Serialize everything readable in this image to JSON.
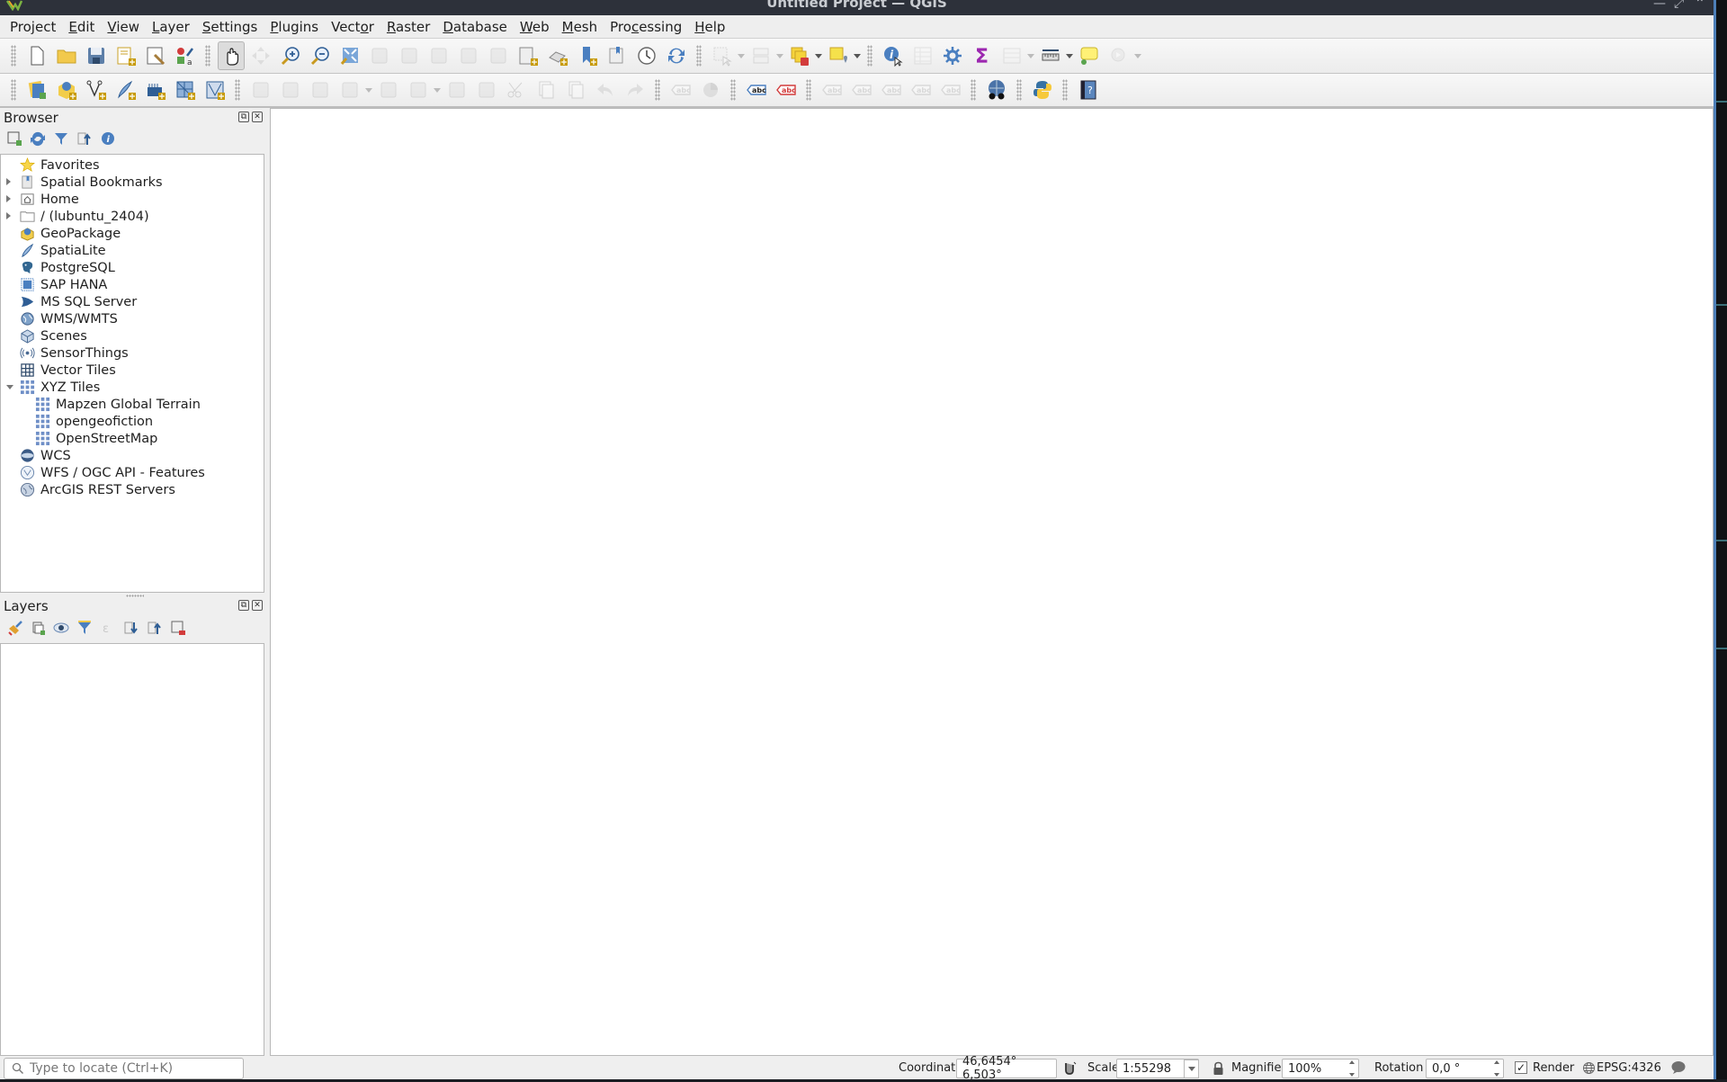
{
  "window": {
    "title": "Untitled Project — QGIS",
    "controls": [
      "minimize",
      "maximize",
      "close"
    ]
  },
  "menubar": {
    "items": [
      {
        "label": "Project",
        "mnemonic_index": 3
      },
      {
        "label": "Edit",
        "mnemonic_index": 0
      },
      {
        "label": "View",
        "mnemonic_index": 0
      },
      {
        "label": "Layer",
        "mnemonic_index": 0
      },
      {
        "label": "Settings",
        "mnemonic_index": 0
      },
      {
        "label": "Plugins",
        "mnemonic_index": 0
      },
      {
        "label": "Vector",
        "mnemonic_index": 4
      },
      {
        "label": "Raster",
        "mnemonic_index": 0
      },
      {
        "label": "Database",
        "mnemonic_index": 0
      },
      {
        "label": "Web",
        "mnemonic_index": 0
      },
      {
        "label": "Mesh",
        "mnemonic_index": 0
      },
      {
        "label": "Processing",
        "mnemonic_index": 3
      },
      {
        "label": "Help",
        "mnemonic_index": 0
      }
    ]
  },
  "toolbar1": {
    "groups": [
      [
        "new-project-icon",
        "open-project-icon",
        "save-project-icon",
        "new-print-layout-icon",
        "layout-manager-icon",
        "style-manager-icon"
      ],
      [
        "pan-icon",
        "pan-to-selection-icon",
        "zoom-in-icon",
        "zoom-out-icon",
        "zoom-full-icon",
        "zoom-to-selection-icon",
        "zoom-to-layer-icon",
        "zoom-native-icon",
        "zoom-last-icon",
        "zoom-next-icon",
        "new-map-view-icon",
        "new-3d-map-view-icon",
        "new-bookmark-icon",
        "show-bookmarks-icon",
        "temporal-controller-icon",
        "refresh-icon"
      ],
      [
        "select-features-icon",
        "attribute-table-select-icon",
        "deselect-icon",
        "select-by-location-icon"
      ],
      [
        "identify-icon",
        "attribute-table-icon",
        "processing-toolbox-icon",
        "statistics-icon",
        "open-field-calculator-icon",
        "measure-icon",
        "map-tips-icon",
        "run-action-icon"
      ]
    ],
    "active_tool": "pan-icon"
  },
  "toolbar2": {
    "groups": [
      [
        "data-source-manager-icon",
        "new-geopackage-layer-icon",
        "new-shapefile-layer-icon",
        "new-spatialite-layer-icon",
        "new-virtual-layer-icon",
        "new-mesh-layer-icon",
        "new-vector-tile-icon"
      ],
      [
        "current-edits-icon",
        "toggle-editing-icon",
        "save-edits-icon",
        "digitize-icon",
        "add-polygon-icon",
        "vertex-tool-icon",
        "modify-attributes-icon",
        "delete-selected-icon",
        "cut-icon",
        "copy-icon",
        "paste-icon",
        "undo-icon",
        "redo-icon"
      ],
      [
        "label-toolbar-icon",
        "diagram-icon"
      ],
      [
        "layer-labeling-icon",
        "layer-labeling-rule-icon"
      ],
      [
        "pin-labels-icon",
        "show-hide-labels-icon",
        "move-label-icon",
        "rotate-label-icon",
        "change-label-icon"
      ],
      [
        "metasearch-icon"
      ],
      [
        "python-console-icon"
      ],
      [
        "help-icon"
      ]
    ]
  },
  "browser": {
    "title": "Browser",
    "toolbar": [
      "add-selected-layers-icon",
      "refresh-icon",
      "filter-icon",
      "collapse-all-icon",
      "info-icon"
    ],
    "items": [
      {
        "label": "Favorites",
        "icon": "star-icon",
        "expander": "none",
        "depth": 0
      },
      {
        "label": "Spatial Bookmarks",
        "icon": "bookmark-icon",
        "expander": "collapsed",
        "depth": 0
      },
      {
        "label": "Home",
        "icon": "home-folder-icon",
        "expander": "collapsed",
        "depth": 0
      },
      {
        "label": "/ (lubuntu_2404)",
        "icon": "folder-icon",
        "expander": "collapsed",
        "depth": 0
      },
      {
        "label": "GeoPackage",
        "icon": "geopackage-icon",
        "expander": "none",
        "depth": 0
      },
      {
        "label": "SpatiaLite",
        "icon": "spatialite-icon",
        "expander": "none",
        "depth": 0
      },
      {
        "label": "PostgreSQL",
        "icon": "postgresql-icon",
        "expander": "none",
        "depth": 0
      },
      {
        "label": "SAP HANA",
        "icon": "sap-hana-icon",
        "expander": "none",
        "depth": 0
      },
      {
        "label": "MS SQL Server",
        "icon": "mssql-icon",
        "expander": "none",
        "depth": 0
      },
      {
        "label": "WMS/WMTS",
        "icon": "wms-icon",
        "expander": "none",
        "depth": 0
      },
      {
        "label": "Scenes",
        "icon": "scenes-icon",
        "expander": "none",
        "depth": 0
      },
      {
        "label": "SensorThings",
        "icon": "sensorthings-icon",
        "expander": "none",
        "depth": 0
      },
      {
        "label": "Vector Tiles",
        "icon": "vector-tiles-icon",
        "expander": "none",
        "depth": 0
      },
      {
        "label": "XYZ Tiles",
        "icon": "xyz-tiles-icon",
        "expander": "expanded",
        "depth": 0
      },
      {
        "label": "Mapzen Global Terrain",
        "icon": "xyz-tiles-icon",
        "expander": "none",
        "depth": 1
      },
      {
        "label": "opengeofiction",
        "icon": "xyz-tiles-icon",
        "expander": "none",
        "depth": 1
      },
      {
        "label": "OpenStreetMap",
        "icon": "xyz-tiles-icon",
        "expander": "none",
        "depth": 1
      },
      {
        "label": "WCS",
        "icon": "wcs-icon",
        "expander": "none",
        "depth": 0
      },
      {
        "label": "WFS / OGC API - Features",
        "icon": "wfs-icon",
        "expander": "none",
        "depth": 0
      },
      {
        "label": "ArcGIS REST Servers",
        "icon": "arcgis-icon",
        "expander": "none",
        "depth": 0
      }
    ]
  },
  "layers": {
    "title": "Layers",
    "toolbar": [
      "open-layer-styling-icon",
      "add-group-icon",
      "manage-visibility-icon",
      "filter-legend-icon",
      "filter-expression-icon",
      "expand-all-icon",
      "collapse-all-icon",
      "remove-layer-icon"
    ],
    "items": []
  },
  "statusbar": {
    "locator_placeholder": "Type to locate (Ctrl+K)",
    "coordinate_label": "Coordinate",
    "coordinate_value": "46,6454° 6,503°",
    "scale_label": "Scale",
    "scale_value": "1:55298",
    "magnifier_label": "Magnifier",
    "magnifier_value": "100%",
    "rotation_label": "Rotation",
    "rotation_value": "0,0 °",
    "render_label": "Render",
    "render_checked": true,
    "crs": "EPSG:4326"
  }
}
